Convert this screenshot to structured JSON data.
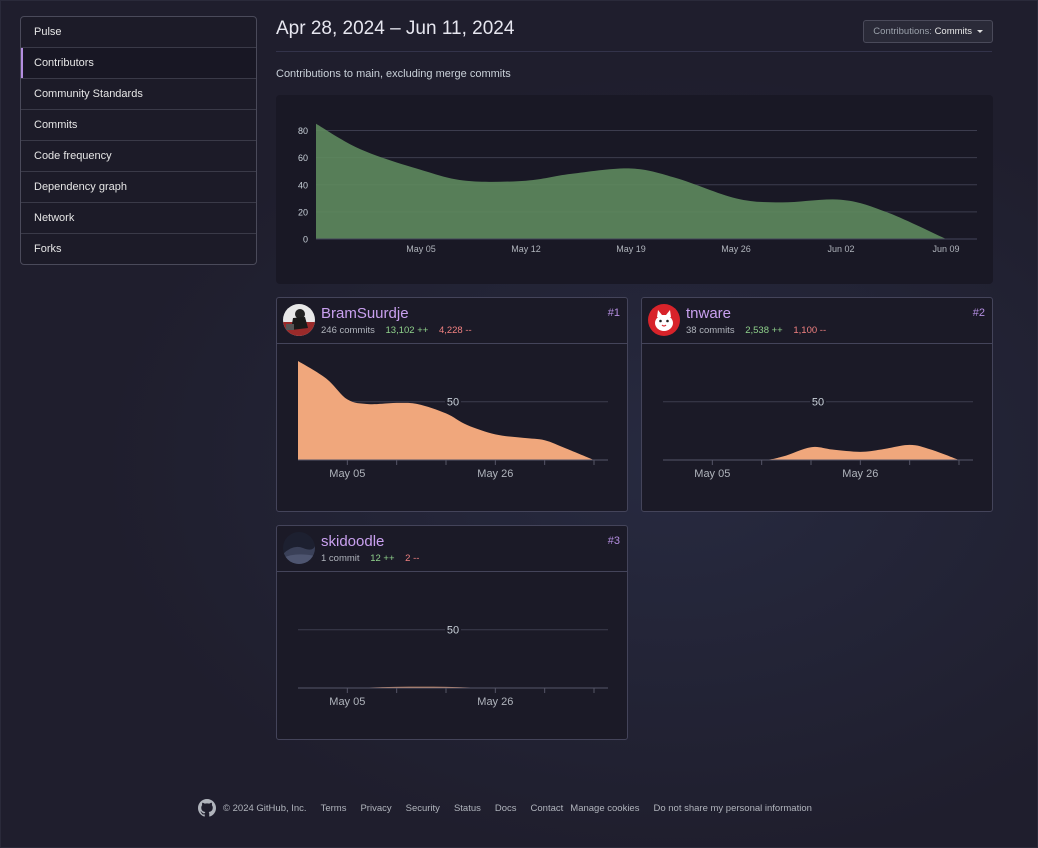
{
  "sidebar": {
    "items": [
      {
        "label": "Pulse"
      },
      {
        "label": "Contributors"
      },
      {
        "label": "Community Standards"
      },
      {
        "label": "Commits"
      },
      {
        "label": "Code frequency"
      },
      {
        "label": "Dependency graph"
      },
      {
        "label": "Network"
      },
      {
        "label": "Forks"
      }
    ],
    "selected": "Contributors"
  },
  "header": {
    "date_range": "Apr 28, 2024 – Jun 11, 2024",
    "contributions_label": "Contributions:",
    "contributions_value": "Commits",
    "subtitle": "Contributions to main, excluding merge commits"
  },
  "colors": {
    "main_area": "#5e8a5e",
    "contributor_area": "#f0a77c",
    "link": "#c9a0ef",
    "additions": "#8fd18b",
    "deletions": "#f08080"
  },
  "chart_data": [
    {
      "type": "area",
      "x": [
        "Apr 28",
        "May 01",
        "May 05",
        "May 08",
        "May 12",
        "May 15",
        "May 19",
        "May 22",
        "May 26",
        "May 29",
        "Jun 02",
        "Jun 05",
        "Jun 09"
      ],
      "series": [
        {
          "values": [
            85,
            66,
            51,
            43,
            43,
            48,
            52,
            45,
            30,
            27,
            29,
            20,
            0
          ]
        }
      ],
      "x_tick_labels": [
        "May 05",
        "May 12",
        "May 19",
        "May 26",
        "Jun 02",
        "Jun 09"
      ],
      "y_tick_labels": [
        "0",
        "20",
        "40",
        "60",
        "80"
      ],
      "ylim": [
        0,
        90
      ],
      "grid": true
    },
    {
      "type": "area",
      "x": [
        "Apr 28",
        "May 02",
        "May 05",
        "May 08",
        "May 12",
        "May 15",
        "May 19",
        "May 22",
        "May 26",
        "May 30",
        "Jun 02",
        "Jun 05",
        "Jun 09"
      ],
      "series": [
        {
          "values": [
            85,
            70,
            52,
            48,
            49,
            48,
            40,
            30,
            22,
            19,
            17,
            10,
            0
          ]
        }
      ],
      "x_tick_labels": [
        "May 05",
        "May 26"
      ],
      "y_tick_labels": [
        "50"
      ],
      "ylim": [
        0,
        85
      ]
    },
    {
      "type": "area",
      "x": [
        "Apr 28",
        "May 05",
        "May 12",
        "May 15",
        "May 19",
        "May 22",
        "May 26",
        "May 29",
        "Jun 02",
        "Jun 05",
        "Jun 09"
      ],
      "series": [
        {
          "values": [
            0,
            0,
            0,
            3,
            11,
            9,
            7,
            9,
            13,
            9,
            0
          ]
        }
      ],
      "x_tick_labels": [
        "May 05",
        "May 26"
      ],
      "y_tick_labels": [
        "50"
      ],
      "ylim": [
        0,
        85
      ]
    },
    {
      "type": "area",
      "x": [
        "Apr 28",
        "May 05",
        "May 12",
        "May 19",
        "May 26",
        "Jun 02",
        "Jun 09"
      ],
      "series": [
        {
          "values": [
            0,
            0,
            1,
            1,
            0,
            0,
            0
          ]
        }
      ],
      "x_tick_labels": [
        "May 05",
        "May 26"
      ],
      "y_tick_labels": [
        "50"
      ],
      "ylim": [
        0,
        85
      ]
    }
  ],
  "contributors": [
    {
      "login": "BramSuurdje",
      "rank": "#1",
      "commits": "246 commits",
      "additions": "13,102 ++",
      "deletions": "4,228 --",
      "avatar_icon": "bramsuurdje-avatar"
    },
    {
      "login": "tnware",
      "rank": "#2",
      "commits": "38 commits",
      "additions": "2,538 ++",
      "deletions": "1,100 --",
      "avatar_icon": "tnware-cat-avatar"
    },
    {
      "login": "skidoodle",
      "rank": "#3",
      "commits": "1 commit",
      "additions": "12 ++",
      "deletions": "2 --",
      "avatar_icon": "skidoodle-avatar"
    }
  ],
  "footer": {
    "copyright": "© 2024 GitHub, Inc.",
    "links": [
      "Terms",
      "Privacy",
      "Security",
      "Status",
      "Docs",
      "Contact",
      "Manage cookies",
      "Do not share my personal information"
    ]
  }
}
